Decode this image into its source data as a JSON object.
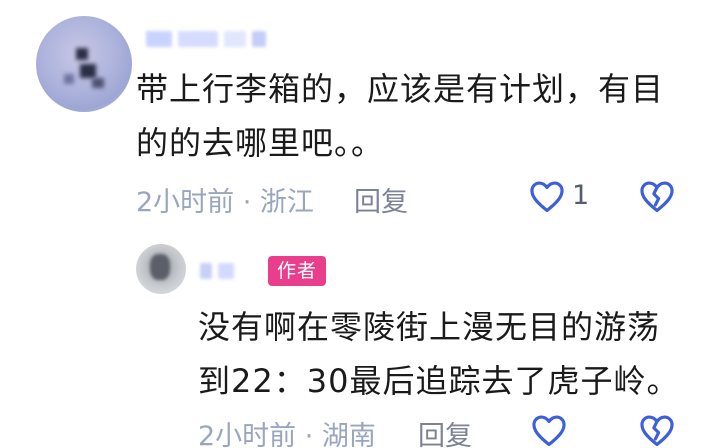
{
  "comments": [
    {
      "text_line1": "带上行李箱的，应该是有计划，有目",
      "text_line2": "的的去哪里吧。。",
      "time_location": "2小时前 · 浙江",
      "reply_label": "回复",
      "like_count": "1"
    },
    {
      "badge": "作者",
      "text_line1": "没有啊在零陵街上漫无目的游荡",
      "text_line2": "到22：30最后追踪去了虎子岭。",
      "time_location": "2小时前 · 湖南",
      "reply_label": "回复"
    }
  ],
  "icons": {
    "like": "heart-outline-icon",
    "dislike": "broken-heart-icon"
  },
  "colors": {
    "text": "#1a1a1a",
    "meta": "#9aa5be",
    "icon_blue": "#3d5fd9",
    "badge": "#e83e8c"
  }
}
